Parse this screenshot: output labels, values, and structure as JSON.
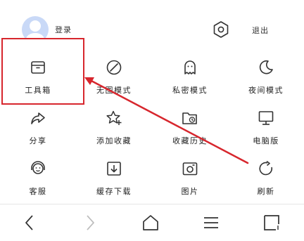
{
  "header": {
    "login_label": "登录",
    "logout_label": "退出"
  },
  "menu": [
    {
      "label": "工具箱",
      "icon": "toolbox-icon"
    },
    {
      "label": "无图模式",
      "icon": "no-image-icon"
    },
    {
      "label": "私密模式",
      "icon": "ghost-icon"
    },
    {
      "label": "夜间模式",
      "icon": "moon-icon"
    },
    {
      "label": "分享",
      "icon": "share-icon"
    },
    {
      "label": "添加收藏",
      "icon": "star-add-icon"
    },
    {
      "label": "收藏历史",
      "icon": "folder-clock-icon"
    },
    {
      "label": "电脑版",
      "icon": "monitor-icon"
    },
    {
      "label": "客服",
      "icon": "headset-icon"
    },
    {
      "label": "缓存下载",
      "icon": "download-icon"
    },
    {
      "label": "图片",
      "icon": "image-icon"
    },
    {
      "label": "刷新",
      "icon": "refresh-icon"
    }
  ],
  "bottom_nav": [
    "back-icon",
    "forward-icon",
    "home-icon",
    "menu-icon",
    "tabs-icon"
  ],
  "annotation_color": "#d7262d"
}
